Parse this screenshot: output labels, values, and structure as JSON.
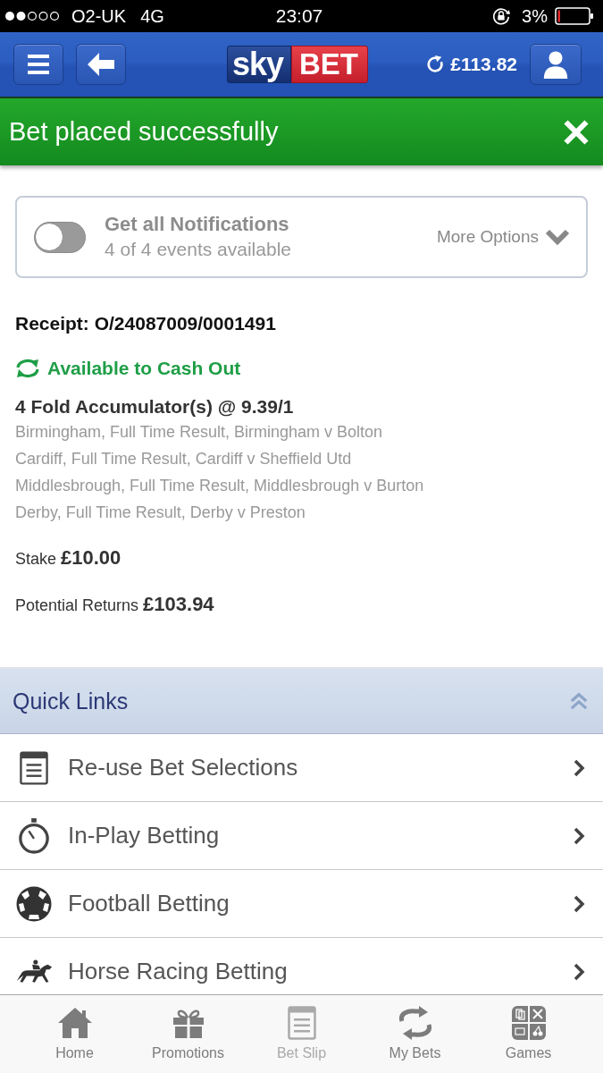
{
  "status_bar": {
    "carrier": "O2-UK",
    "network": "4G",
    "time": "23:07",
    "battery": "3%"
  },
  "header": {
    "logo": {
      "left": "sky",
      "right": "BET"
    },
    "balance": "£113.82"
  },
  "banner": {
    "message": "Bet placed successfully"
  },
  "notifications": {
    "on": false,
    "title": "Get all Notifications",
    "subtitle": "4 of 4 events available",
    "more": "More Options"
  },
  "receipt": {
    "number": "Receipt: O/24087009/0001491",
    "cash_out": "Available to Cash Out",
    "bet_type": "4 Fold Accumulator(s) @ 9.39/1",
    "selections": [
      "Birmingham, Full Time Result, Birmingham v Bolton",
      "Cardiff, Full Time Result, Cardiff v Sheffield Utd",
      "Middlesbrough, Full Time Result, Middlesbrough v Burton",
      "Derby, Full Time Result, Derby v Preston"
    ],
    "stake": {
      "label": "Stake",
      "value": "£10.00"
    },
    "returns": {
      "label": "Potential Returns",
      "value": "£103.94"
    }
  },
  "quick_links": {
    "title": "Quick Links",
    "expanded": true,
    "items": [
      {
        "kind": "slip",
        "label": "Re-use Bet Selections"
      },
      {
        "kind": "timer",
        "label": "In-Play Betting"
      },
      {
        "kind": "football",
        "label": "Football Betting"
      },
      {
        "kind": "horse",
        "label": "Horse Racing Betting"
      }
    ]
  },
  "tab_bar": [
    {
      "kind": "home",
      "label": "Home",
      "disabled": false
    },
    {
      "kind": "promotions",
      "label": "Promotions",
      "disabled": false
    },
    {
      "kind": "betslip",
      "label": "Bet Slip",
      "disabled": true
    },
    {
      "kind": "mybets",
      "label": "My Bets",
      "disabled": false
    },
    {
      "kind": "games",
      "label": "Games",
      "disabled": false
    }
  ]
}
